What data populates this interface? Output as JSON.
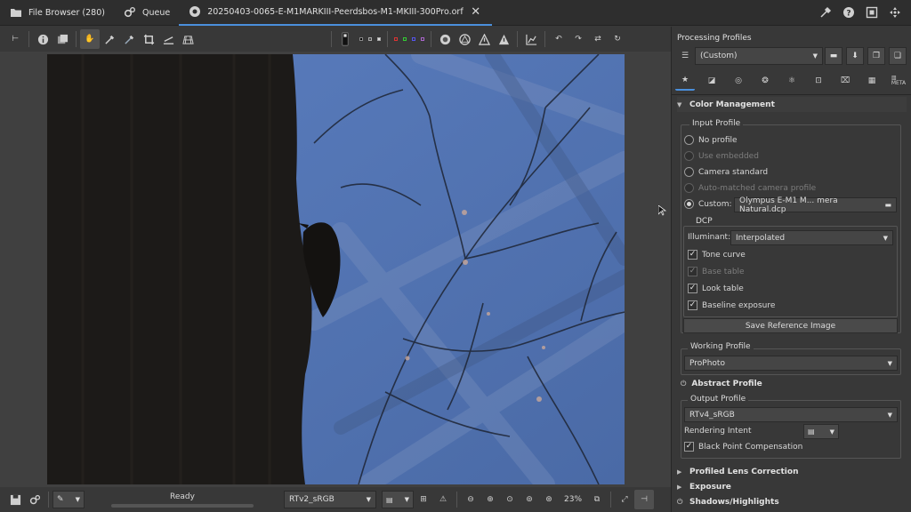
{
  "tabs": [
    {
      "label": "File Browser (280)",
      "icon": "folder-icon"
    },
    {
      "label": "Queue",
      "icon": "gears-icon"
    },
    {
      "label": "20250403-0065-E-M1MARKIII-Peerdsbos-M1-MKIII-300Pro.orf",
      "icon": "camera-aperture-icon",
      "active": true
    }
  ],
  "status": {
    "text": "Ready"
  },
  "bottom": {
    "output_profile": "RTv2_sRGB",
    "zoom": "23%"
  },
  "panel": {
    "title": "Processing Profiles",
    "profile": "(Custom)",
    "section_color_management": "Color Management",
    "input_profile": {
      "legend": "Input Profile",
      "options": [
        {
          "label": "No profile",
          "checked": false,
          "disabled": false
        },
        {
          "label": "Use embedded",
          "checked": false,
          "disabled": true
        },
        {
          "label": "Camera standard",
          "checked": false,
          "disabled": false
        },
        {
          "label": "Auto-matched camera profile",
          "checked": false,
          "disabled": true
        },
        {
          "label": "Custom:",
          "checked": true,
          "disabled": false
        }
      ],
      "custom_file": "Olympus E-M1 M... mera Natural.dcp"
    },
    "dcp": {
      "legend": "DCP",
      "illuminant_label": "Illuminant:",
      "illuminant_value": "Interpolated",
      "checks": [
        {
          "label": "Tone curve",
          "checked": true,
          "disabled": false
        },
        {
          "label": "Base table",
          "checked": true,
          "disabled": true
        },
        {
          "label": "Look table",
          "checked": true,
          "disabled": false
        },
        {
          "label": "Baseline exposure",
          "checked": true,
          "disabled": false
        }
      ]
    },
    "save_reference": "Save Reference Image",
    "working_profile": {
      "legend": "Working Profile",
      "value": "ProPhoto"
    },
    "abstract_profile": "Abstract Profile",
    "output_profile": {
      "legend": "Output Profile",
      "value": "RTv4_sRGB",
      "rendering_intent_label": "Rendering Intent",
      "black_point_label": "Black Point Compensation",
      "black_point_checked": true
    },
    "collapsed_sections": [
      "Profiled Lens Correction",
      "Exposure",
      "Shadows/Highlights"
    ]
  },
  "colors": {
    "accent": "#4a8fdc",
    "sky": "#4f72b0",
    "tree": "#1c1a18"
  }
}
